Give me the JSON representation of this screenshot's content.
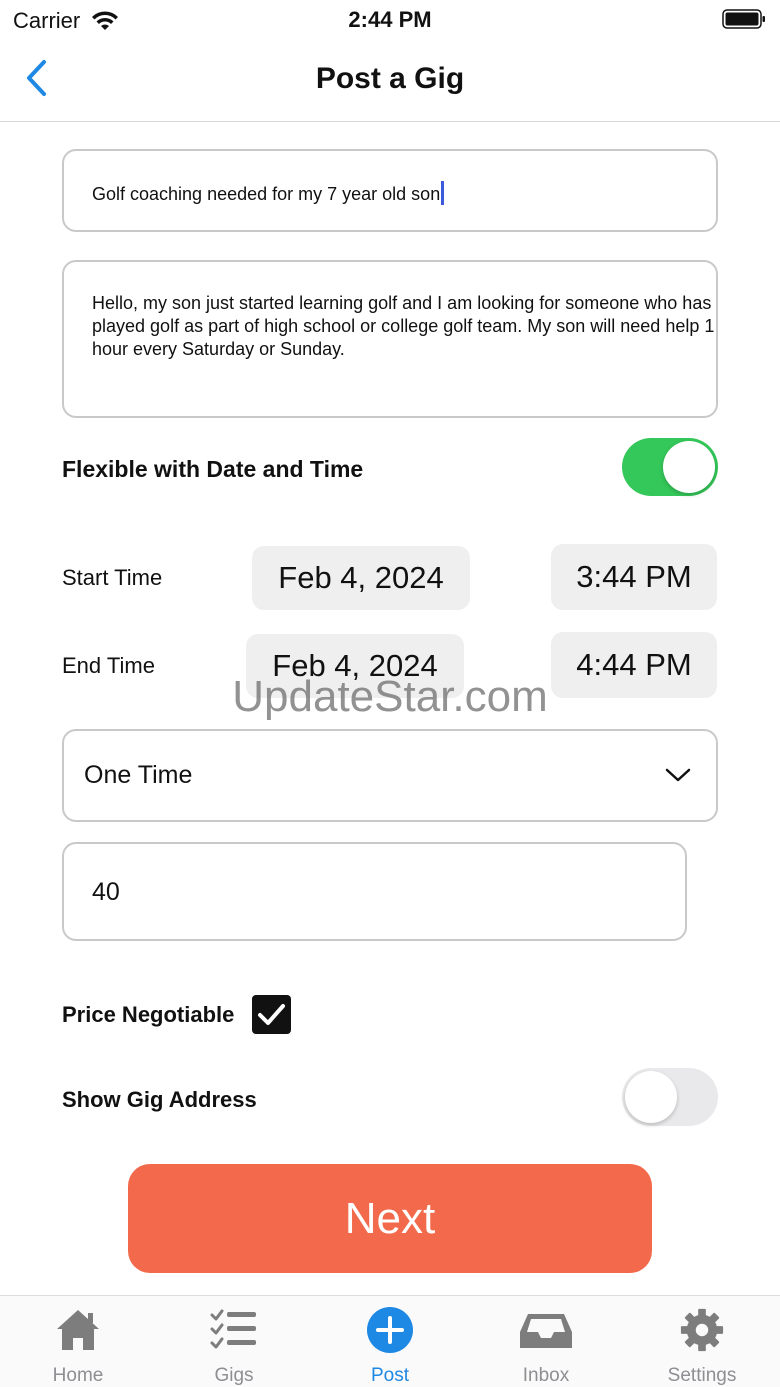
{
  "status_bar": {
    "carrier": "Carrier",
    "time": "2:44 PM",
    "icons": [
      "wifi-icon",
      "battery-icon"
    ]
  },
  "nav": {
    "title": "Post a Gig",
    "back_icon": "chevron-left-icon",
    "accent": "#1e88e5"
  },
  "form": {
    "title_value": "Golf coaching needed for my 7 year old son",
    "description_value": "Hello, my son just started learning golf and I am looking for someone who has played golf as part of high school or college golf team. My son will need help 1 hour every Saturday or Sunday.",
    "flexible": {
      "label": "Flexible with Date and Time",
      "on": true
    },
    "start": {
      "label": "Start Time",
      "date": "Feb 4, 2024",
      "time": "3:44 PM"
    },
    "end": {
      "label": "End Time",
      "date": "Feb 4, 2024",
      "time": "4:44 PM"
    },
    "frequency": {
      "value": "One Time",
      "icon": "chevron-down-icon"
    },
    "price_value": "40",
    "price_negotiable": {
      "label": "Price Negotiable",
      "checked": true
    },
    "show_address": {
      "label": "Show Gig Address",
      "on": false
    },
    "next_label": "Next",
    "next_color": "#f26a4b",
    "toggle_on_color": "#34c759"
  },
  "watermark": "UpdateStar.com",
  "tabs": [
    {
      "label": "Home",
      "icon": "home-icon",
      "active": false
    },
    {
      "label": "Gigs",
      "icon": "list-checks-icon",
      "active": false
    },
    {
      "label": "Post",
      "icon": "plus-circle-icon",
      "active": true
    },
    {
      "label": "Inbox",
      "icon": "inbox-icon",
      "active": false
    },
    {
      "label": "Settings",
      "icon": "gear-icon",
      "active": false
    }
  ]
}
